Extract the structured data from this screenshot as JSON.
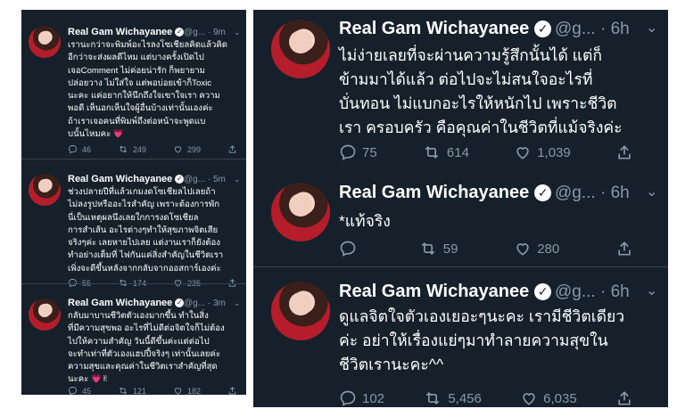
{
  "left": {
    "tweets": [
      {
        "name": "Real Gam Wichayanee",
        "handle": "@g...",
        "time": "· 9m",
        "text": "เรานะกว่าจะพิมพ์อะไรลงโซเชียลคิดแล้วคิด\nอีกว่าจะส่งผลดีไหม แต่บางครั้งเปิดไป\nเจอComment ไม่ค่อยน่ารัก ก็พยายาม\nปล่อยวาง ไม่ใส่ใจ แต่พอบ่อยเข้าก็Toxic\nนะคะ แค่อยากให้นึกถึงใจเขาใจเรา ความ\nพอดี เห็นอกเห็นใจผู้อื่นบ้างเท่านั้นเองค่ะ\nถ้าเราเจอคนที่พิมพ์ถึงต่อหน้าจะพูดแบ\nบนั้นไหมคะ 💗",
        "replies": "46",
        "retweets": "249",
        "likes": "299"
      },
      {
        "name": "Real Gam Wichayanee",
        "handle": "@g...",
        "time": "· 5m",
        "text": "ช่วงปลายปีที่แล้วเกมงดโซเชียลไปเลยถ้า\nไม่ลงรูปหรืออะไรสำคัญ เพราะต้องการพัก\nนี่เป็นเหตุผลนึงเลยใกการงดโซเชียล\nการสำเส้น อะไรต่างๆทำให้สุขภาพจิตเสีย\nจริงๆค่ะ เลยหายไปเลย แต่งานเราก็ยังต้อง\nทำอย่างเต็มที่ ไฟกันแค่สิ่งสำคัญในชีวิตเรา\nเพิ่งจะดีขึ้นหลังจากกลับจากออสการ์เองค่ะ",
        "replies": "55",
        "retweets": "174",
        "likes": "235"
      },
      {
        "name": "Real Gam Wichayanee",
        "handle": "@g...",
        "time": "· 3m",
        "text": "กลับมาบานชีวิตตัวเองมากขึ้น ทำในสิ่ง\nที่มีความสุขพอ อะไรที่ไม่ดีต่อจิตใจก็ไม่ต้อง\nไปให้ความสำคัญ วันนี้ดีขึ้นค่ะแต่ต่อไป\nจะทำเท่าที่ตัวเองแฮปปี้จริงๆ เท่านั้นเลยค่ะ\nความสุขและคุณค่าในชีวิตเราสำคัญที่สุด\nนะคะ 💗✌",
        "replies": "45",
        "retweets": "121",
        "likes": "182"
      }
    ]
  },
  "right": {
    "tweets": [
      {
        "name": "Real Gam Wichayanee",
        "handle": "@g...",
        "time": "· 6h",
        "text": "ไม่ง่ายเลยที่จะผ่านความรู้สึกนั้นได้ แต่ก็\nข้ามมาได้แล้ว ต่อไปจะไม่สนใจอะไรที่\nบั่นทอน ไม่แบกอะไรให้หนักไป เพราะชีวิต\nเรา ครอบครัว คือคุณค่าในชีวิตที่แม้จริงค่ะ",
        "replies": "75",
        "retweets": "614",
        "likes": "1,039"
      },
      {
        "name": "Real Gam Wichayanee",
        "handle": "@g...",
        "time": "· 6h",
        "text": "*แท้จริง",
        "replies": "",
        "retweets": "59",
        "likes": "280"
      },
      {
        "name": "Real Gam Wichayanee",
        "handle": "@g...",
        "time": "· 6h",
        "text": "ดูแลจิตใจตัวเองเยอะๆนะคะ เรามีชีวิตเดียว\nค่ะ อย่าให้เรื่องแย่ๆมาทำลายความสุขใน\nชีวิตเรานะคะ^^",
        "replies": "102",
        "retweets": "5,456",
        "likes": "6,035"
      }
    ]
  },
  "icons": {
    "verified": "verified-badge-icon",
    "reply": "reply-icon",
    "retweet": "retweet-icon",
    "like": "heart-icon",
    "share": "share-icon",
    "more": "chevron-down-icon"
  },
  "colors": {
    "background": "#15202b",
    "secondary_text": "#8899a6",
    "divider": "#38444d"
  }
}
